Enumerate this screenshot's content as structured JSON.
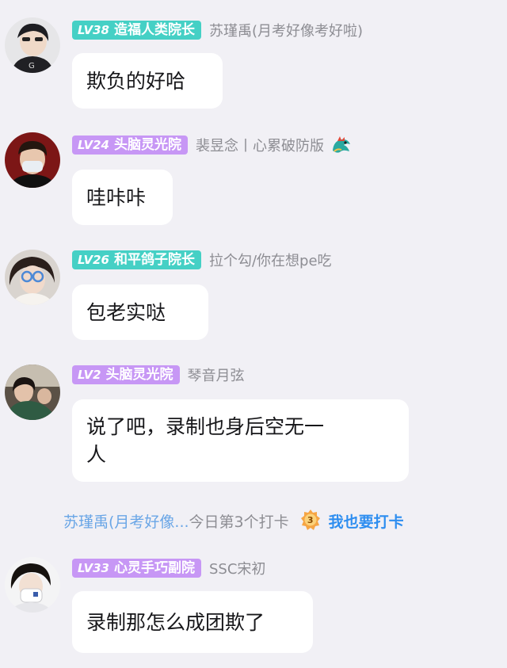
{
  "messages": [
    {
      "level": "LV38",
      "title": "造福人类院长",
      "badge_color": "#45d0c5",
      "username": "苏瑾禹(月考好像考好啦)",
      "text": "欺负的好哈"
    },
    {
      "level": "LV24",
      "title": "头脑灵光院",
      "badge_color": "#c797f5",
      "username": "裴昱念丨心累破防版",
      "username_icon": "dragon-icon",
      "text": "哇咔咔"
    },
    {
      "level": "LV26",
      "title": "和平鸽子院长",
      "badge_color": "#45d0c5",
      "username": "拉个勾/你在想pe吃",
      "text": "包老实哒"
    },
    {
      "level": "LV2",
      "title": "头脑灵光院",
      "badge_color": "#c797f5",
      "username": "琴音月弦",
      "text_line1": "说了吧，录制也身后空无一",
      "text_line2": "人"
    },
    {
      "level": "LV33",
      "title": "心灵手巧副院",
      "badge_color": "#c797f5",
      "username": "SSC宋初",
      "text": "录制那怎么成团欺了"
    }
  ],
  "checkin": {
    "user": "苏瑾禹(月考好像...",
    "text": "今日第3个打卡",
    "medal_number": "3",
    "join_label": "我也要打卡"
  }
}
